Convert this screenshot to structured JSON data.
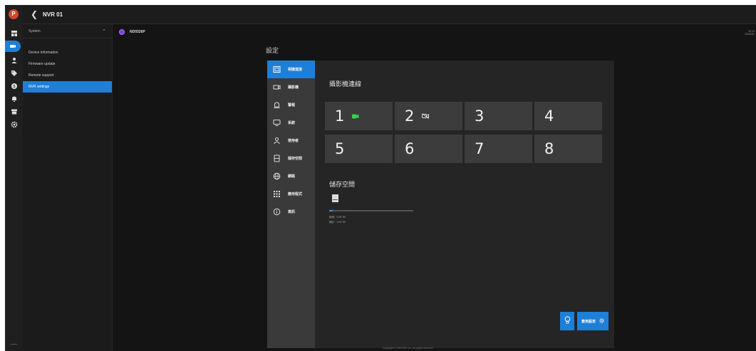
{
  "app": {
    "logo_letter": "P",
    "window_title": "NVR 01",
    "back_icon": "chevron-left-icon"
  },
  "rail": {
    "icons": [
      "dashboard-icon",
      "camera-icon",
      "user-icon",
      "tag-icon",
      "dollar-icon",
      "bell-icon",
      "box-icon",
      "gear-icon"
    ],
    "active": "camera-icon"
  },
  "sidepanel": {
    "section": "System",
    "items": [
      "Device information",
      "Firmware update",
      "Remote support",
      "NVR settings"
    ],
    "active_item": "NVR settings"
  },
  "device": {
    "name": "ND9326P",
    "datetime_line1": "20:12",
    "datetime_line2": "2024/3/1"
  },
  "settings": {
    "title": "設定",
    "nav": [
      {
        "icon": "camera-connection-icon",
        "label": "相機連接"
      },
      {
        "icon": "video-icon",
        "label": "攝影機"
      },
      {
        "icon": "bell-outline-icon",
        "label": "警報"
      },
      {
        "icon": "monitor-icon",
        "label": "系統"
      },
      {
        "icon": "user-outline-icon",
        "label": "使用者"
      },
      {
        "icon": "storage-icon",
        "label": "儲存空間"
      },
      {
        "icon": "globe-icon",
        "label": "網路"
      },
      {
        "icon": "apps-grid-icon",
        "label": "應用程式"
      },
      {
        "icon": "info-icon",
        "label": "資訊"
      }
    ],
    "active_nav": 0
  },
  "camera_section": {
    "title": "攝影機連線",
    "slots": [
      {
        "number": "1",
        "status": "connected"
      },
      {
        "number": "2",
        "status": "disconnected"
      },
      {
        "number": "3",
        "status": "empty"
      },
      {
        "number": "4",
        "status": "empty"
      },
      {
        "number": "5",
        "status": "empty"
      },
      {
        "number": "6",
        "status": "empty"
      },
      {
        "number": "7",
        "status": "empty"
      },
      {
        "number": "8",
        "status": "empty"
      }
    ]
  },
  "storage_section": {
    "title": "儲存空間",
    "usage_fraction": 0.04,
    "used_line": "使用：0.05 TB",
    "total_line": "總計：1.00 TB"
  },
  "actions": {
    "help_icon": "lightbulb-icon",
    "apply_label": "套用設定",
    "apply_icon": "gear-small-icon"
  },
  "footer": {
    "text": "Copyright © VIVOTEK Inc. All rights reserved."
  },
  "colors": {
    "accent": "#1e7fd8",
    "connected": "#3ccf4e",
    "background": "#141414"
  }
}
